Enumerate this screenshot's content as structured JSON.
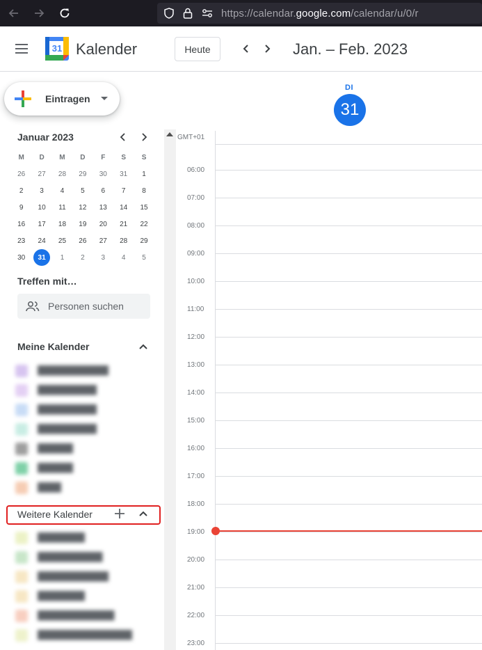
{
  "browser": {
    "url_prefix": "https://calendar.",
    "url_domain": "google.com",
    "url_path": "/calendar/u/0/r"
  },
  "header": {
    "logo_number": "31",
    "title": "Kalender",
    "today_label": "Heute",
    "period": "Jan. – Feb. 2023"
  },
  "sidebar": {
    "create_label": "Eintragen",
    "mini_calendar": {
      "title": "Januar 2023",
      "weekdays": [
        "M",
        "D",
        "M",
        "D",
        "F",
        "S",
        "S"
      ],
      "weeks": [
        [
          "26",
          "27",
          "28",
          "29",
          "30",
          "31",
          "1"
        ],
        [
          "2",
          "3",
          "4",
          "5",
          "6",
          "7",
          "8"
        ],
        [
          "9",
          "10",
          "11",
          "12",
          "13",
          "14",
          "15"
        ],
        [
          "16",
          "17",
          "18",
          "19",
          "20",
          "21",
          "22"
        ],
        [
          "23",
          "24",
          "25",
          "26",
          "27",
          "28",
          "29"
        ],
        [
          "30",
          "31",
          "1",
          "2",
          "3",
          "4",
          "5"
        ]
      ]
    },
    "meet_title": "Treffen mit…",
    "people_search_placeholder": "Personen suchen",
    "my_calendars_title": "Meine Kalender",
    "other_calendars_title": "Weitere Kalender",
    "colors": {
      "my": [
        "#d7c4f0",
        "#e4d0f4",
        "#c8dcf6",
        "#c9ede4",
        "#9e9e9e",
        "#7fd1a8",
        "#f6cdb4"
      ],
      "other": [
        "#ecf2c6",
        "#c8e6c9",
        "#f7e7c4",
        "#f7e7c4",
        "#f8cfc0",
        "#eef2cc"
      ]
    }
  },
  "grid": {
    "day_name": "DI",
    "day_number": "31",
    "timezone": "GMT+01",
    "hours": [
      "06:00",
      "07:00",
      "08:00",
      "09:00",
      "10:00",
      "11:00",
      "12:00",
      "13:00",
      "14:00",
      "15:00",
      "16:00",
      "17:00",
      "18:00",
      "19:00",
      "20:00",
      "21:00",
      "22:00",
      "23:00"
    ]
  },
  "accent": "#1a73e8",
  "now_indicator_color": "#ea4335"
}
